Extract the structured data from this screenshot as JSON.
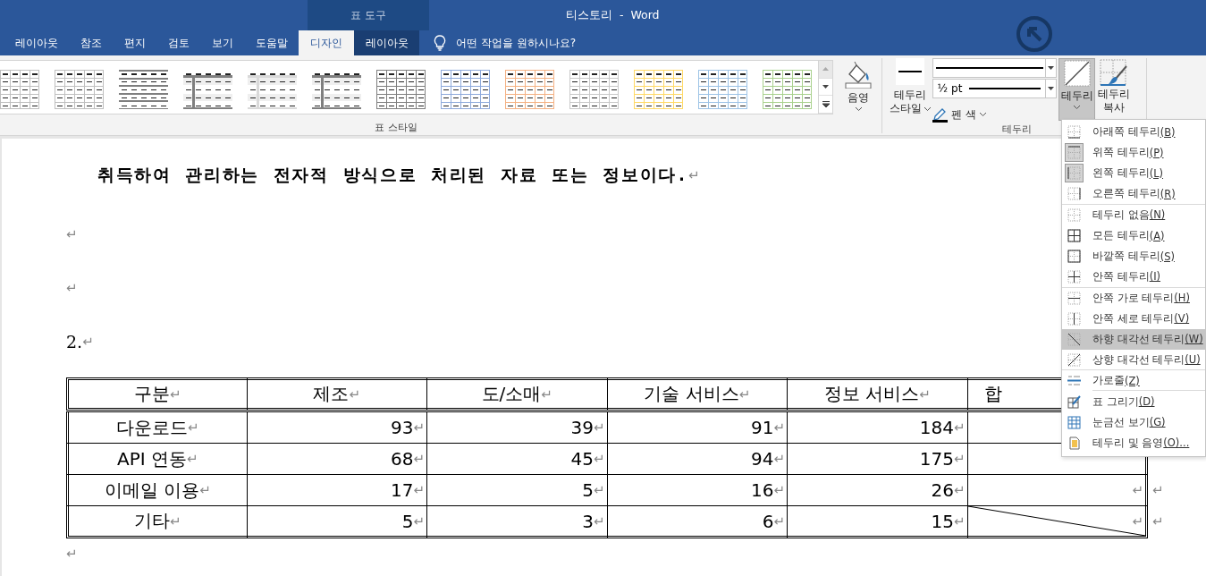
{
  "window": {
    "title": "티스토리  -  Word",
    "context_tab_group": "표 도구"
  },
  "tabs": [
    {
      "label": "레이아웃",
      "selected": false,
      "context": false
    },
    {
      "label": "참조",
      "selected": false,
      "context": false
    },
    {
      "label": "편지",
      "selected": false,
      "context": false
    },
    {
      "label": "검토",
      "selected": false,
      "context": false
    },
    {
      "label": "보기",
      "selected": false,
      "context": false
    },
    {
      "label": "도움말",
      "selected": false,
      "context": false
    },
    {
      "label": "디자인",
      "selected": true,
      "context": true
    },
    {
      "label": "레이아웃",
      "selected": false,
      "context": true
    }
  ],
  "tell_me": {
    "placeholder": "어떤 작업을 원하시나요?"
  },
  "ribbon": {
    "style_gallery": [
      {
        "kind": "grid",
        "color": "#bfbfbf"
      },
      {
        "kind": "grid",
        "color": "#bfbfbf"
      },
      {
        "kind": "lines",
        "color": "#7f7f7f"
      },
      {
        "kind": "plain",
        "color": "#7f7f7f"
      },
      {
        "kind": "plain",
        "color": "#d9d9d9"
      },
      {
        "kind": "plain",
        "color": "#7f7f7f"
      },
      {
        "kind": "grid",
        "color": "#7f7f7f"
      },
      {
        "kind": "grid",
        "color": "#8eaadb"
      },
      {
        "kind": "grid",
        "color": "#f4b183"
      },
      {
        "kind": "grid",
        "color": "#c9c9c9"
      },
      {
        "kind": "grid",
        "color": "#ffd966"
      },
      {
        "kind": "grid",
        "color": "#9dc3e6"
      },
      {
        "kind": "grid",
        "color": "#a9d18e"
      }
    ],
    "shading": {
      "label": "음영"
    },
    "style_group_label": "표 스타일",
    "border_styles": {
      "label_line1": "테두리",
      "label_line2": "스타일"
    },
    "line_weight": "½ pt",
    "pen_color": {
      "label": "펜 색"
    },
    "borders_button": {
      "label": "테두리",
      "pressed": true
    },
    "border_painter": {
      "label_line1": "테두리",
      "label_line2": "복사"
    },
    "border_group_label": "테두리"
  },
  "document": {
    "lines": [
      {
        "kind": "bold",
        "text": "취득하여 관리하는 전자적 방식으로 처리된 자료 또는 정보이다.",
        "mark": "↵"
      },
      {
        "kind": "empty",
        "mark": "↵"
      },
      {
        "kind": "empty",
        "mark": "↵"
      },
      {
        "kind": "normal",
        "text": "2.",
        "mark": "↵"
      }
    ],
    "table": {
      "columns": [
        {
          "text": "구분",
          "mark": "↵"
        },
        {
          "text": "제조",
          "mark": "↵"
        },
        {
          "text": "도/소매",
          "mark": "↵"
        },
        {
          "text": "기술 서비스",
          "mark": "↵"
        },
        {
          "text": "정보 서비스",
          "mark": "↵"
        },
        {
          "text": "합"
        }
      ],
      "rows": [
        {
          "cells": [
            {
              "text": "다운로드",
              "mark": "↵"
            },
            {
              "text": "93",
              "mark": "↵"
            },
            {
              "text": "39",
              "mark": "↵"
            },
            {
              "text": "91",
              "mark": "↵"
            },
            {
              "text": "184",
              "mark": "↵"
            },
            {}
          ]
        },
        {
          "cells": [
            {
              "text": "API 연동",
              "mark": "↵"
            },
            {
              "text": "68",
              "mark": "↵"
            },
            {
              "text": "45",
              "mark": "↵"
            },
            {
              "text": "94",
              "mark": "↵"
            },
            {
              "text": "175",
              "mark": "↵"
            },
            {}
          ]
        },
        {
          "cells": [
            {
              "text": "이메일 이용",
              "mark": "↵"
            },
            {
              "text": "17",
              "mark": "↵"
            },
            {
              "text": "5",
              "mark": "↵"
            },
            {
              "text": "16",
              "mark": "↵"
            },
            {
              "text": "26",
              "mark": "↵"
            },
            {
              "mark": "↵"
            }
          ],
          "end_mark": "↵"
        },
        {
          "cells": [
            {
              "text": "기타",
              "mark": "↵"
            },
            {
              "text": "5",
              "mark": "↵"
            },
            {
              "text": "3",
              "mark": "↵"
            },
            {
              "text": "6",
              "mark": "↵"
            },
            {
              "text": "15",
              "mark": "↵"
            },
            {
              "mark": "↵",
              "diagonal": true
            }
          ],
          "end_mark": "↵"
        }
      ]
    },
    "trailing_mark": "↵"
  },
  "borders_menu": [
    {
      "kind": "bottom",
      "label": "아래쪽 테두리",
      "key": "(B)",
      "on": false,
      "selected": false,
      "separator_after": false
    },
    {
      "kind": "top",
      "label": "위쪽 테두리",
      "key": "(P)",
      "on": true,
      "selected": false,
      "separator_after": false
    },
    {
      "kind": "left",
      "label": "왼쪽 테두리",
      "key": "(L)",
      "on": true,
      "selected": false,
      "separator_after": false
    },
    {
      "kind": "right",
      "label": "오른쪽 테두리",
      "key": "(R)",
      "on": false,
      "selected": false,
      "separator_after": true
    },
    {
      "kind": "none",
      "label": "테두리 없음",
      "key": "(N)",
      "on": false,
      "selected": false,
      "separator_after": false
    },
    {
      "kind": "all",
      "label": "모든 테두리",
      "key": "(A)",
      "on": false,
      "selected": false,
      "separator_after": false
    },
    {
      "kind": "outside",
      "label": "바깥쪽 테두리",
      "key": "(S)",
      "on": false,
      "selected": false,
      "separator_after": false
    },
    {
      "kind": "inside",
      "label": "안쪽 테두리",
      "key": "(I)",
      "on": false,
      "selected": false,
      "separator_after": true
    },
    {
      "kind": "inside-h",
      "label": "안쪽 가로 테두리",
      "key": "(H)",
      "on": false,
      "selected": false,
      "separator_after": false
    },
    {
      "kind": "inside-v",
      "label": "안쪽 세로 테두리",
      "key": "(V)",
      "on": false,
      "selected": false,
      "separator_after": false
    },
    {
      "kind": "diag-down",
      "label": "하향 대각선 테두리",
      "key": "(W)",
      "on": false,
      "selected": true,
      "separator_after": false
    },
    {
      "kind": "diag-up",
      "label": "상향 대각선 테두리",
      "key": "(U)",
      "on": false,
      "selected": false,
      "separator_after": true
    },
    {
      "kind": "hline",
      "label": "가로줄",
      "key": "(Z)",
      "on": false,
      "selected": false,
      "separator_after": true
    },
    {
      "kind": "draw",
      "label": "표 그리기",
      "key": "(D)",
      "on": false,
      "selected": false,
      "separator_after": false
    },
    {
      "kind": "grid",
      "label": "눈금선 보기",
      "key": "(G)",
      "on": false,
      "selected": false,
      "separator_after": false
    },
    {
      "kind": "shading",
      "label": "테두리 및 음영",
      "key": "(O)...",
      "on": false,
      "selected": false,
      "separator_after": false
    }
  ]
}
